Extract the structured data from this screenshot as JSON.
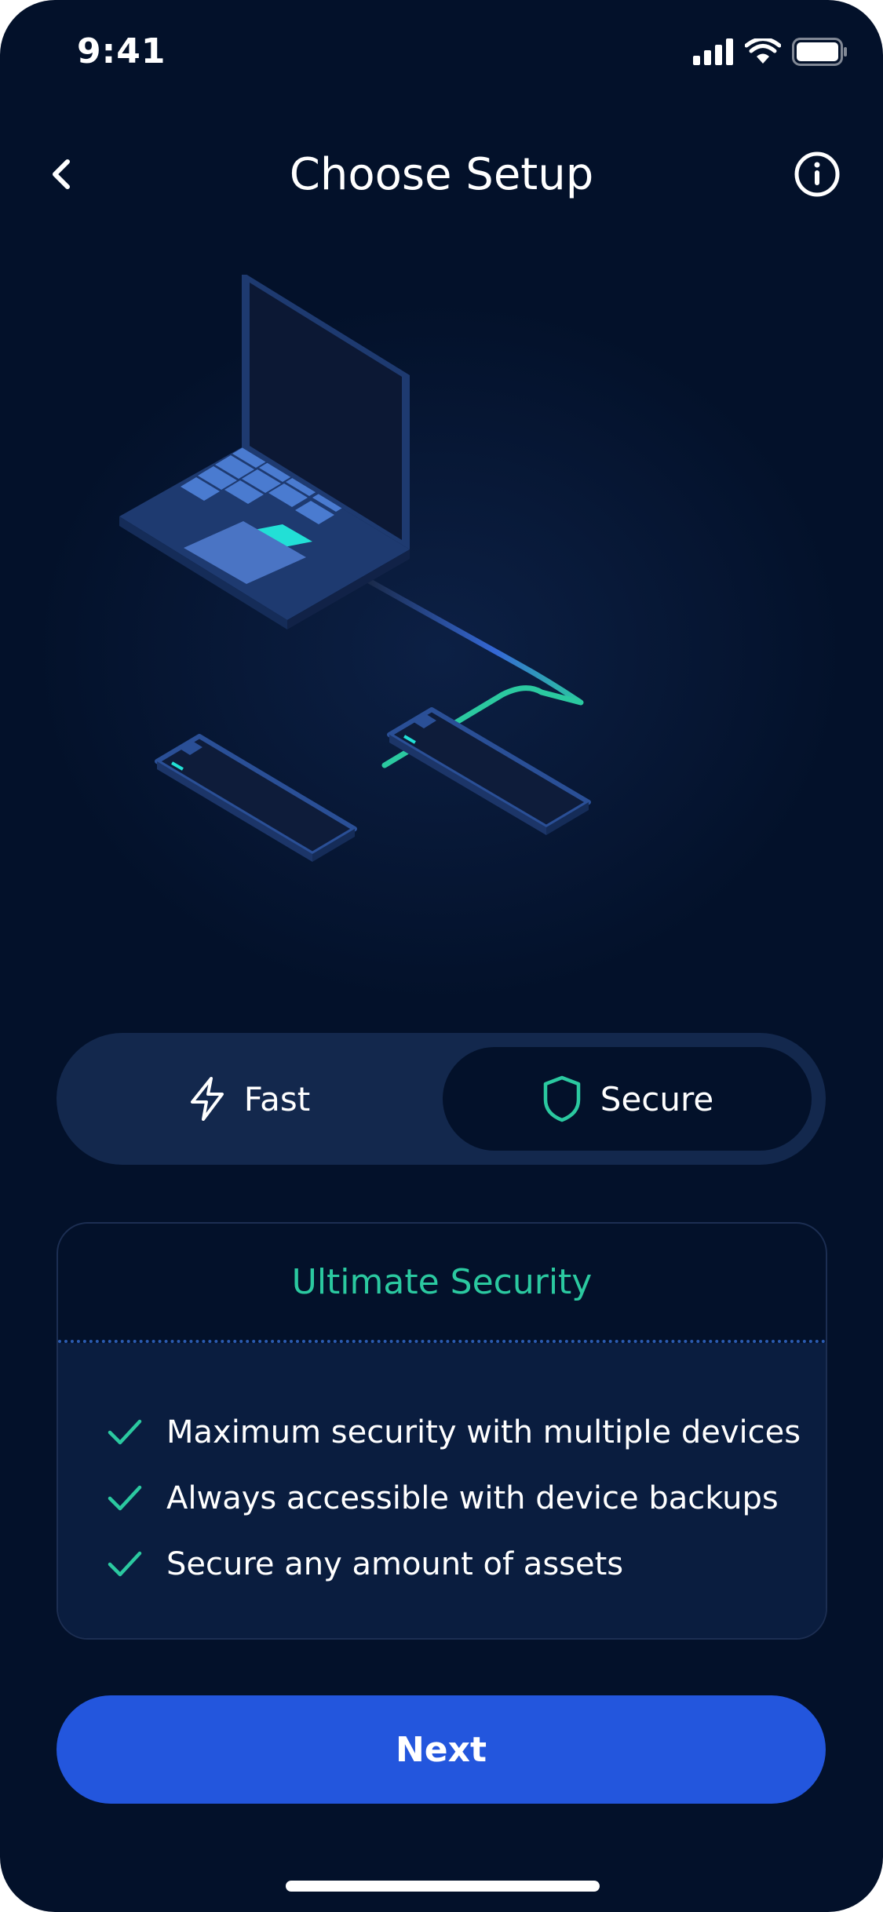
{
  "status_bar": {
    "time": "9:41"
  },
  "nav": {
    "title": "Choose Setup"
  },
  "toggle": {
    "options": [
      {
        "label": "Fast",
        "icon": "lightning-icon",
        "selected": false
      },
      {
        "label": "Secure",
        "icon": "shield-icon",
        "selected": true
      }
    ]
  },
  "card": {
    "title": "Ultimate Security",
    "features": [
      "Maximum security with multiple devices",
      "Always accessible with device backups",
      "Secure any amount of assets"
    ]
  },
  "next_button": {
    "label": "Next"
  },
  "colors": {
    "background": "#03112a",
    "accent_teal": "#2bc9a0",
    "primary_blue": "#2356dd",
    "toggle_bg": "#13284d"
  }
}
